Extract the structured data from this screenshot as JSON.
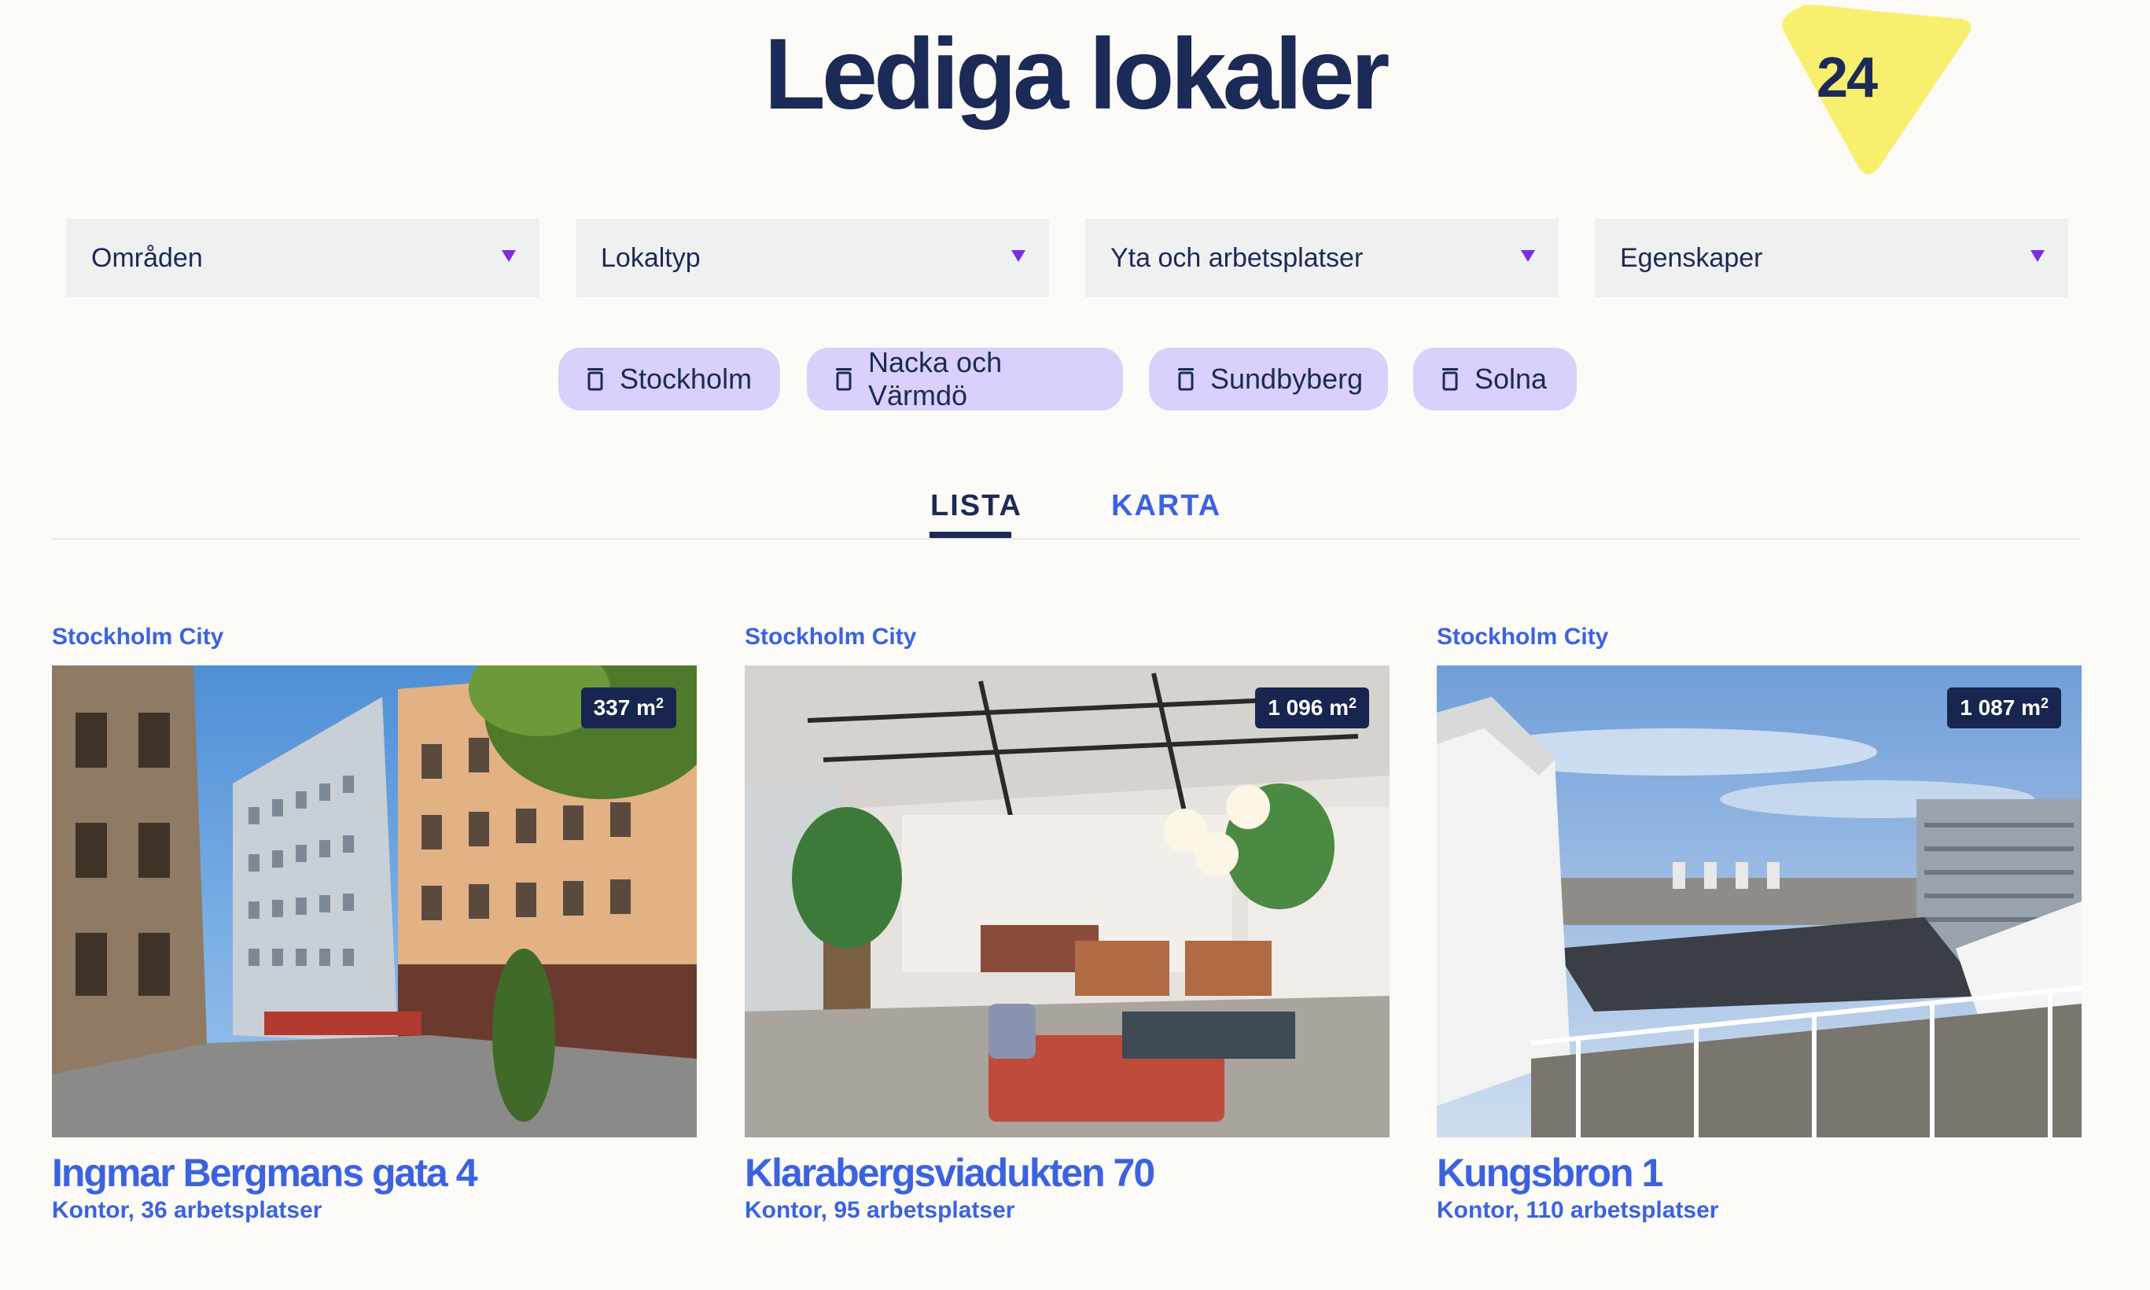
{
  "page": {
    "title": "Lediga lokaler",
    "result_count": "24"
  },
  "filters": [
    {
      "label": "Områden"
    },
    {
      "label": "Lokaltyp"
    },
    {
      "label": "Yta och arbetsplatser"
    },
    {
      "label": "Egenskaper"
    }
  ],
  "active_chips": [
    {
      "label": "Stockholm"
    },
    {
      "label": "Nacka och Värmdö"
    },
    {
      "label": "Sundbyberg"
    },
    {
      "label": "Solna"
    }
  ],
  "view_tabs": {
    "list": "LISTA",
    "map": "KARTA",
    "active": "LISTA"
  },
  "listings": [
    {
      "area": "Stockholm City",
      "size": "337 m",
      "size_unit_sup": "2",
      "address": "Ingmar Bergmans gata 4",
      "description": "Kontor, 36 arbetsplatser"
    },
    {
      "area": "Stockholm City",
      "size": "1 096 m",
      "size_unit_sup": "2",
      "address": "Klarabergsviadukten 70",
      "description": "Kontor, 95 arbetsplatser"
    },
    {
      "area": "Stockholm City",
      "size": "1 087 m",
      "size_unit_sup": "2",
      "address": "Kungsbron 1",
      "description": "Kontor, 110 arbetsplatser"
    }
  ],
  "colors": {
    "background": "#fdfbf8",
    "primary_text": "#1b2a56",
    "accent_link": "#3b63e0",
    "chip_background": "#d9d0fb",
    "badge_yellow": "#f8ef6f",
    "caret_purple": "#7b2ee0"
  }
}
